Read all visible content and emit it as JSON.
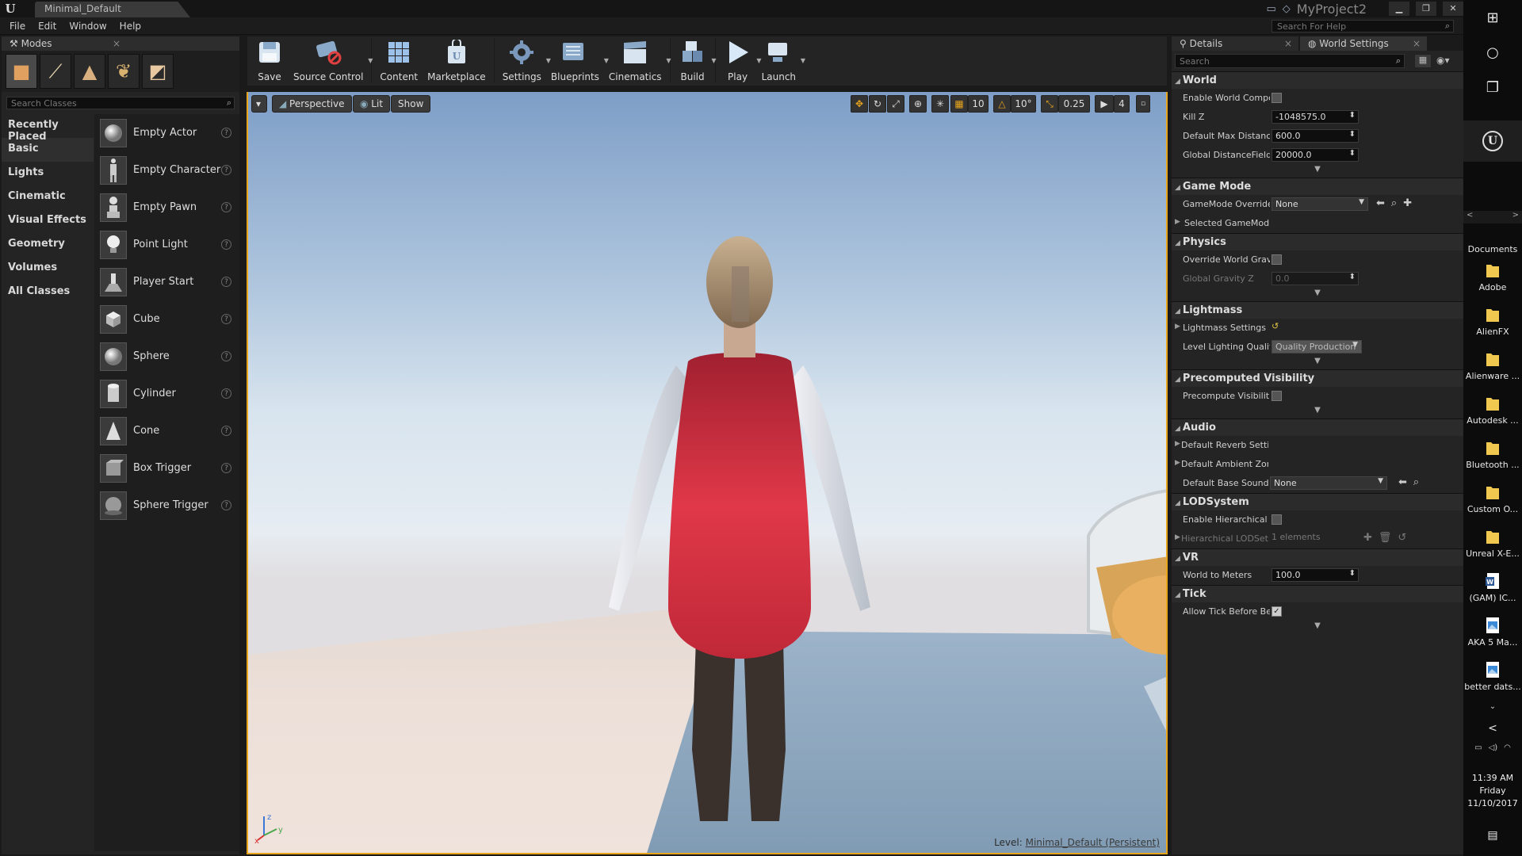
{
  "titlebar": {
    "tab": "Minimal_Default",
    "project": "MyProject2"
  },
  "menu": {
    "items": [
      "File",
      "Edit",
      "Window",
      "Help"
    ],
    "help_search_placeholder": "Search For Help"
  },
  "modes": {
    "tab_label": "Modes",
    "search_placeholder": "Search Classes",
    "categories": [
      "Recently Placed",
      "Basic",
      "Lights",
      "Cinematic",
      "Visual Effects",
      "Geometry",
      "Volumes",
      "All Classes"
    ],
    "active_category": "Basic",
    "items": [
      "Empty Actor",
      "Empty Character",
      "Empty Pawn",
      "Point Light",
      "Player Start",
      "Cube",
      "Sphere",
      "Cylinder",
      "Cone",
      "Box Trigger",
      "Sphere Trigger"
    ]
  },
  "toolbar": {
    "buttons": [
      {
        "label": "Save",
        "icon": "save-icon"
      },
      {
        "label": "Source Control",
        "icon": "source-control-icon"
      },
      {
        "label": "Content",
        "icon": "content-icon"
      },
      {
        "label": "Marketplace",
        "icon": "marketplace-icon"
      },
      {
        "label": "Settings",
        "icon": "settings-icon"
      },
      {
        "label": "Blueprints",
        "icon": "blueprints-icon"
      },
      {
        "label": "Cinematics",
        "icon": "cinematics-icon"
      },
      {
        "label": "Build",
        "icon": "build-icon"
      },
      {
        "label": "Play",
        "icon": "play-icon"
      },
      {
        "label": "Launch",
        "icon": "launch-icon"
      }
    ]
  },
  "viewport": {
    "perspective": "Perspective",
    "lit": "Lit",
    "show": "Show",
    "grid_snap": "10",
    "rotation_snap": "10°",
    "scale_snap": "0.25",
    "camera_speed": "4",
    "level_prefix": "Level:",
    "level_name": "Minimal_Default (Persistent)",
    "axis": {
      "x": "x",
      "y": "y",
      "z": "z"
    }
  },
  "details": {
    "tabs": [
      "Details",
      "World Settings"
    ],
    "search_placeholder": "Search",
    "world": {
      "title": "World",
      "enable_world_comp": "Enable World Compo",
      "kill_z_label": "Kill Z",
      "kill_z": "-1048575.0",
      "max_dist_label": "Default Max Distanc",
      "max_dist": "600.0",
      "gdf_label": "Global DistanceField",
      "gdf": "20000.0"
    },
    "game_mode": {
      "title": "Game Mode",
      "override_label": "GameMode Override",
      "override_value": "None",
      "selected_label": "Selected GameMod"
    },
    "physics": {
      "title": "Physics",
      "override_gravity_label": "Override World Gravi",
      "gravity_z_label": "Global Gravity Z",
      "gravity_z": "0.0"
    },
    "lightmass": {
      "title": "Lightmass",
      "settings_label": "Lightmass Settings",
      "quality_label": "Level Lighting Qualit",
      "quality": "Quality Production"
    },
    "precomputed": {
      "title": "Precomputed Visibility",
      "label": "Precompute Visibilit"
    },
    "audio": {
      "title": "Audio",
      "reverb_label": "Default Reverb Setti",
      "ambient_label": "Default Ambient Zon",
      "base_sound_label": "Default Base Sound I",
      "base_sound": "None"
    },
    "lod": {
      "title": "LODSystem",
      "enable_label": "Enable Hierarchical L",
      "hlod_label": "Hierarchical LODSet",
      "hlod_value": "1 elements"
    },
    "vr": {
      "title": "VR",
      "meters_label": "World to Meters",
      "meters": "100.0"
    },
    "tick": {
      "title": "Tick",
      "allow_label": "Allow Tick Before Be"
    }
  },
  "taskbar": {
    "desktop_header": "Documents",
    "desktop_items": [
      "Adobe",
      "AlienFX",
      "Alienware ...",
      "Autodesk ...",
      "Bluetooth ...",
      "Custom O...",
      "Unreal X-E...",
      "(GAM) IC...",
      "AKA 5 Ma...",
      "better dats..."
    ],
    "time": "11:39 AM",
    "day": "Friday",
    "date": "11/10/2017"
  }
}
